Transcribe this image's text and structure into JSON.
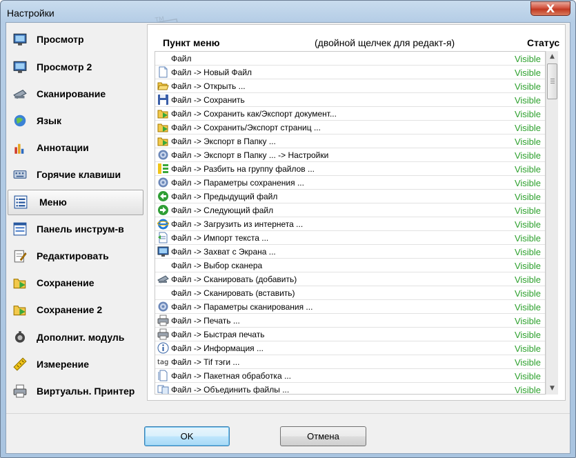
{
  "window": {
    "title": "Настройки",
    "close_glyph": "X"
  },
  "sidebar": {
    "items": [
      {
        "label": "Просмотр",
        "icon": "monitor-icon"
      },
      {
        "label": "Просмотр 2",
        "icon": "monitor-icon"
      },
      {
        "label": "Сканирование",
        "icon": "scanner-icon"
      },
      {
        "label": "Язык",
        "icon": "globe-icon"
      },
      {
        "label": "Аннотации",
        "icon": "annotation-icon"
      },
      {
        "label": "Горячие клавиши",
        "icon": "keyboard-icon"
      },
      {
        "label": "Меню",
        "icon": "menu-list-icon",
        "selected": true
      },
      {
        "label": "Панель инструм-в",
        "icon": "toolbar-icon"
      },
      {
        "label": "Редактировать",
        "icon": "edit-icon"
      },
      {
        "label": "Сохранение",
        "icon": "save-folder-icon"
      },
      {
        "label": "Сохранение 2",
        "icon": "save-folder-icon"
      },
      {
        "label": "Дополнит. модуль",
        "icon": "plugin-icon"
      },
      {
        "label": "Измерение",
        "icon": "ruler-icon"
      },
      {
        "label": "Виртуальн. Принтер",
        "icon": "printer-icon"
      }
    ]
  },
  "panel": {
    "col_item": "Пункт меню",
    "col_hint": "(двойной щелчек для редакт-я)",
    "col_status": "Статус"
  },
  "menu_rows": [
    {
      "label": "Файл",
      "status": "Visible",
      "icon": "none"
    },
    {
      "label": "Файл -> Новый Файл",
      "status": "Visible",
      "icon": "new-file-icon"
    },
    {
      "label": "Файл -> Открыть ...",
      "status": "Visible",
      "icon": "open-folder-icon"
    },
    {
      "label": "Файл -> Сохранить",
      "status": "Visible",
      "icon": "floppy-icon"
    },
    {
      "label": "Файл -> Сохранить как/Экспорт документ...",
      "status": "Visible",
      "icon": "export-icon"
    },
    {
      "label": "Файл -> Сохранить/Экспорт страниц ...",
      "status": "Visible",
      "icon": "export-icon"
    },
    {
      "label": "Файл -> Экспорт в Папку ...",
      "status": "Visible",
      "icon": "export-icon"
    },
    {
      "label": "Файл -> Экспорт в Папку ... -> Настройки",
      "status": "Visible",
      "icon": "gear-icon"
    },
    {
      "label": "Файл -> Разбить на группу файлов ...",
      "status": "Visible",
      "icon": "split-icon"
    },
    {
      "label": "Файл -> Параметры сохранения ...",
      "status": "Visible",
      "icon": "gear-icon"
    },
    {
      "label": "Файл -> Предыдущий файл",
      "status": "Visible",
      "icon": "arrow-left-icon"
    },
    {
      "label": "Файл -> Следующий файл",
      "status": "Visible",
      "icon": "arrow-right-icon"
    },
    {
      "label": "Файл -> Загрузить из интернета ...",
      "status": "Visible",
      "icon": "ie-icon"
    },
    {
      "label": "Файл -> Импорт текста ...",
      "status": "Visible",
      "icon": "text-import-icon"
    },
    {
      "label": "Файл -> Захват с Экрана ...",
      "status": "Visible",
      "icon": "screen-capture-icon"
    },
    {
      "label": "Файл -> Выбор сканера",
      "status": "Visible",
      "icon": "none"
    },
    {
      "label": "Файл -> Сканировать (добавить)",
      "status": "Visible",
      "icon": "scanner-icon"
    },
    {
      "label": "Файл -> Сканировать (вставить)",
      "status": "Visible",
      "icon": "none"
    },
    {
      "label": "Файл -> Параметры сканирования ...",
      "status": "Visible",
      "icon": "gear-icon"
    },
    {
      "label": "Файл -> Печать ...",
      "status": "Visible",
      "icon": "printer-icon"
    },
    {
      "label": "Файл -> Быстрая печать",
      "status": "Visible",
      "icon": "printer-icon"
    },
    {
      "label": "Файл -> Информация ...",
      "status": "Visible",
      "icon": "info-icon"
    },
    {
      "label": "Файл -> Tif тэги ...",
      "status": "Visible",
      "icon": "tag-icon"
    },
    {
      "label": "Файл -> Пакетная обработка ...",
      "status": "Visible",
      "icon": "batch-icon"
    },
    {
      "label": "Файл -> Объединить файлы ...",
      "status": "Visible",
      "icon": "merge-icon"
    }
  ],
  "buttons": {
    "ok": "OK",
    "cancel": "Отмена"
  },
  "watermark": {
    "text": "SOFTPORTAL",
    "tm": "TM",
    "url": "www.softportal.com"
  },
  "colors": {
    "status_visible": "#2ca02c",
    "selected_item_bg": "#e8e8e8",
    "window_frame": "#b5cde6"
  }
}
